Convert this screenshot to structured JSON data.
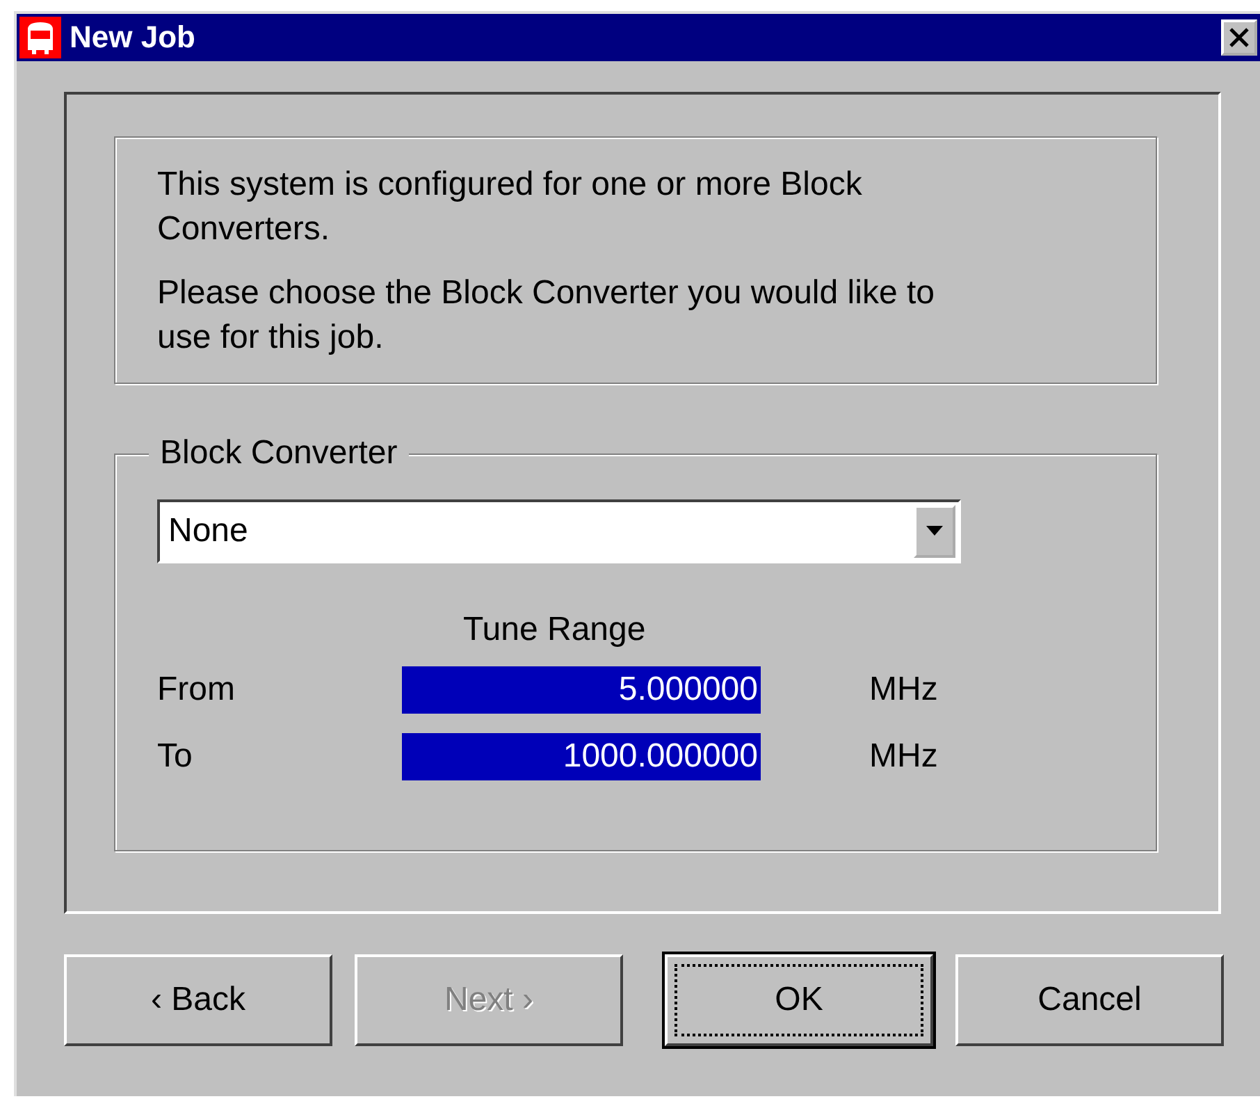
{
  "window": {
    "title": "New Job"
  },
  "info": [
    "This system is configured for one or more Block Converters.",
    "Please choose the Block Converter you would like to use for this job."
  ],
  "block_converter": {
    "legend": "Block Converter",
    "value": "None",
    "tune_range": {
      "heading": "Tune Range",
      "rows": [
        {
          "label": "From",
          "value": "5.000000",
          "unit": "MHz"
        },
        {
          "label": "To",
          "value": "1000.000000",
          "unit": "MHz"
        }
      ]
    }
  },
  "buttons": [
    {
      "label": "‹ Back",
      "disabled": false,
      "default": false
    },
    {
      "label": "Next ›",
      "disabled": true,
      "default": false
    },
    {
      "label": "OK",
      "disabled": false,
      "default": true
    },
    {
      "label": "Cancel",
      "disabled": false,
      "default": false
    }
  ]
}
